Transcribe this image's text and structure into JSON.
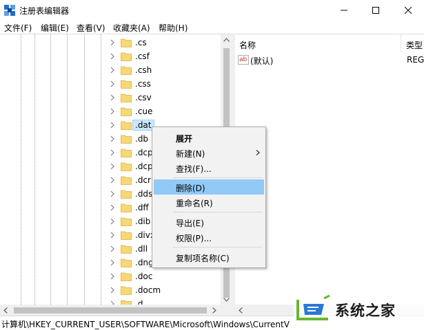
{
  "window": {
    "title": "注册表编辑器"
  },
  "menu": {
    "file": "文件(F)",
    "edit": "编辑(E)",
    "view": "查看(V)",
    "favorites": "收藏夹(A)",
    "help": "帮助(H)"
  },
  "tree": {
    "items": [
      {
        "label": ".cs"
      },
      {
        "label": ".csf"
      },
      {
        "label": ".csh"
      },
      {
        "label": ".css"
      },
      {
        "label": ".csv"
      },
      {
        "label": ".cue"
      },
      {
        "label": ".dat",
        "selected": true
      },
      {
        "label": ".db"
      },
      {
        "label": ".dcp"
      },
      {
        "label": ".dcp"
      },
      {
        "label": ".dcr"
      },
      {
        "label": ".dds"
      },
      {
        "label": ".dff"
      },
      {
        "label": ".dib"
      },
      {
        "label": ".divx"
      },
      {
        "label": ".dll"
      },
      {
        "label": ".dng"
      },
      {
        "label": ".doc"
      },
      {
        "label": ".docm"
      },
      {
        "label": ".d"
      }
    ]
  },
  "values": {
    "headers": {
      "name": "名称",
      "type": "类型"
    },
    "rows": [
      {
        "name": "(默认)",
        "type": "REG"
      }
    ],
    "icon_glyph": "ab"
  },
  "status": {
    "path": "计算机\\HKEY_CURRENT_USER\\SOFTWARE\\Microsoft\\Windows\\CurrentV"
  },
  "context_menu": {
    "expand": "展开",
    "new": "新建(N)",
    "find": "查找(F)...",
    "delete": "删除(D)",
    "rename": "重命名(R)",
    "export": "导出(E)",
    "permissions": "权限(P)...",
    "copy_key_name": "复制项名称(C)",
    "highlighted": "删除(D)"
  },
  "watermark": {
    "text": "系统之家"
  },
  "colors": {
    "accent": "#91c9f7",
    "folder": "#f8d775",
    "selection": "#cce8ff",
    "logo_blue": "#2a7ad5",
    "logo_green": "#66b82e"
  }
}
